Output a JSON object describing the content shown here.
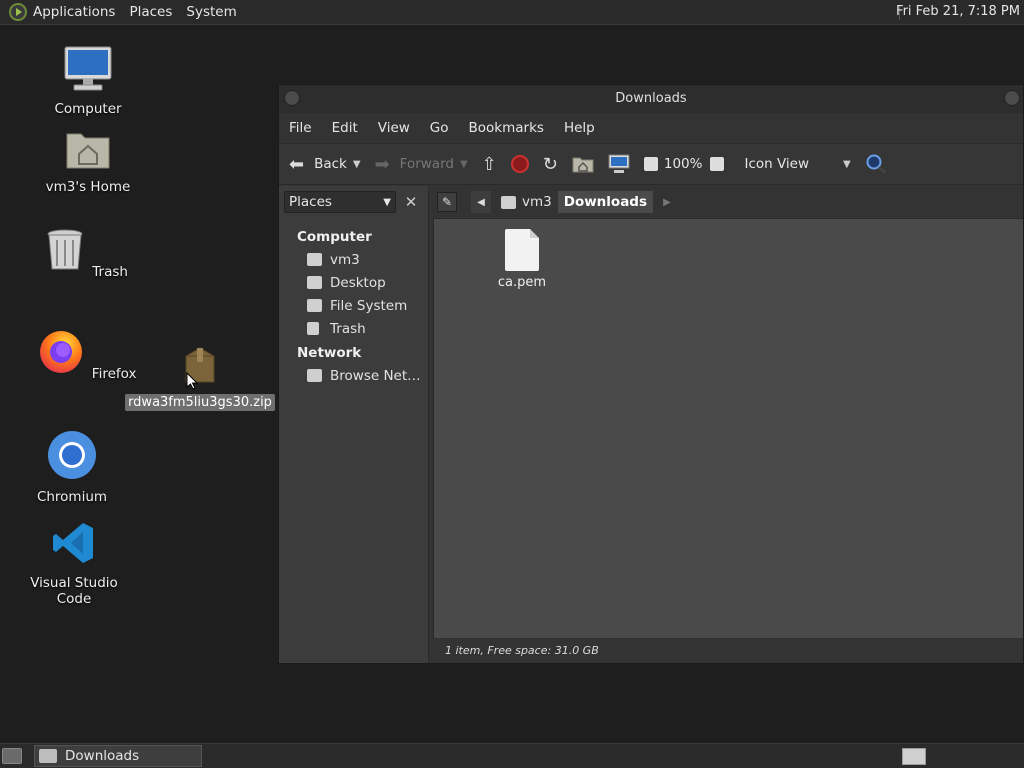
{
  "top_panel": {
    "menus": [
      "Applications",
      "Places",
      "System"
    ],
    "clock": "Fri Feb 21,  7:18 PM"
  },
  "desktop": {
    "icons": [
      {
        "label": "Computer"
      },
      {
        "label": "vm3's Home"
      },
      {
        "label": "Trash"
      },
      {
        "label": "Firefox"
      },
      {
        "label": "Chromium"
      },
      {
        "label": "Visual Studio Code"
      }
    ],
    "dragged_file": "rdwa3fm5liu3gs30.zip"
  },
  "window": {
    "title": "Downloads",
    "menubar": [
      "File",
      "Edit",
      "View",
      "Go",
      "Bookmarks",
      "Help"
    ],
    "toolbar": {
      "back": "Back",
      "forward": "Forward",
      "zoom": "100%",
      "view_mode": "Icon View"
    },
    "sidebar": {
      "selector": "Places",
      "sections": [
        {
          "title": "Computer",
          "items": [
            "vm3",
            "Desktop",
            "File System",
            "Trash"
          ]
        },
        {
          "title": "Network",
          "items": [
            "Browse Net…"
          ]
        }
      ]
    },
    "pathbar": [
      "vm3",
      "Downloads"
    ],
    "files": [
      {
        "name": "ca.pem"
      }
    ],
    "status": "1 item, Free space: 31.0 GB"
  },
  "bottom_panel": {
    "task": "Downloads"
  },
  "colors": {
    "panel": "#2a2a2a",
    "window_bg": "#333333",
    "view_bg": "#4a4a4a",
    "desktop_bg": "#1e1e1e"
  }
}
